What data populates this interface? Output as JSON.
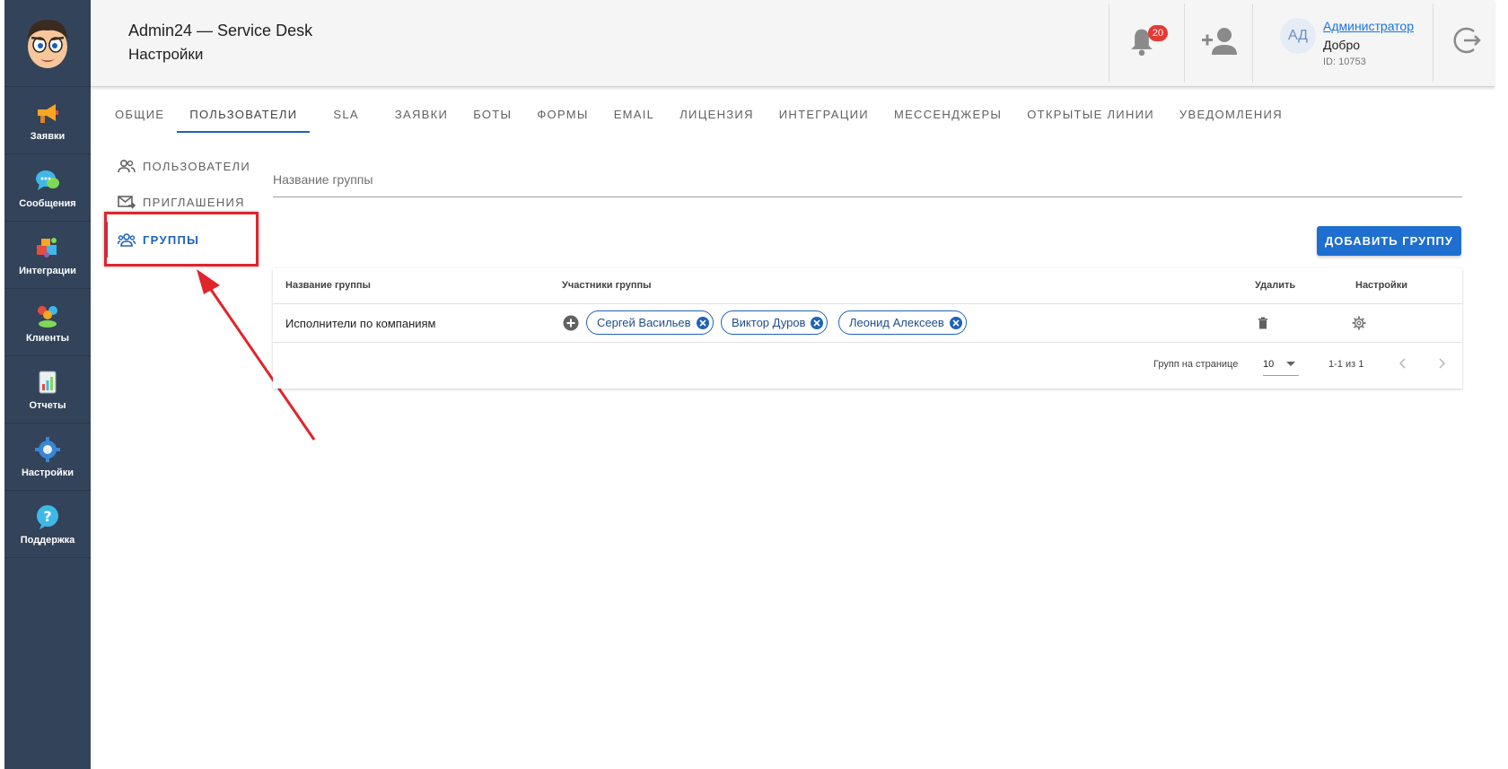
{
  "header": {
    "title": "Admin24 — Service Desk",
    "subtitle": "Настройки",
    "notifications_count": "20",
    "user": {
      "initials": "АД",
      "name": "Администратор",
      "greeting": "Добро",
      "id": "ID: 10753"
    }
  },
  "sidebar": {
    "items": [
      {
        "label": "Заявки",
        "icon": "megaphone-icon"
      },
      {
        "label": "Сообщения",
        "icon": "chat-bubble-icon"
      },
      {
        "label": "Интеграции",
        "icon": "puzzle-icon"
      },
      {
        "label": "Клиенты",
        "icon": "people-icon"
      },
      {
        "label": "Отчеты",
        "icon": "report-icon"
      },
      {
        "label": "Настройки",
        "icon": "gear-icon"
      },
      {
        "label": "Поддержка",
        "icon": "help-icon"
      }
    ]
  },
  "tabs": [
    "ОБЩИЕ",
    "ПОЛЬЗОВАТЕЛИ",
    "SLA",
    "ЗАЯВКИ",
    "БОТЫ",
    "ФОРМЫ",
    "EMAIL",
    "ЛИЦЕНЗИЯ",
    "ИНТЕГРАЦИИ",
    "МЕССЕНДЖЕРЫ",
    "ОТКРЫТЫЕ ЛИНИИ",
    "УВЕДОМЛЕНИЯ"
  ],
  "active_tab": "ПОЛЬЗОВАТЕЛИ",
  "submenu": {
    "items": [
      {
        "label": "ПОЛЬЗОВАТЕЛИ",
        "icon": "users-icon"
      },
      {
        "label": "ПРИГЛАШЕНИЯ",
        "icon": "mail-forward-icon"
      },
      {
        "label": "ГРУППЫ",
        "icon": "groups-icon"
      }
    ],
    "active": "ГРУППЫ"
  },
  "search": {
    "placeholder": "Название группы",
    "value": ""
  },
  "add_button": "ДОБАВИТЬ ГРУППУ",
  "table": {
    "headers": [
      "Название группы",
      "Участники группы",
      "Удалить",
      "Настройки"
    ],
    "rows": [
      {
        "name": "Исполнители по компаниям",
        "members": [
          "Сергей Васильев",
          "Виктор Дуров",
          "Леонид Алексеев"
        ]
      }
    ],
    "pagination": {
      "label": "Групп на странице",
      "per_page": "10",
      "range": "1-1 из 1"
    }
  },
  "colors": {
    "sidebar": "#33435a",
    "accent": "#1e63b8",
    "button": "#1e6fd0",
    "badge": "#e53935",
    "highlight": "#e0252b"
  }
}
